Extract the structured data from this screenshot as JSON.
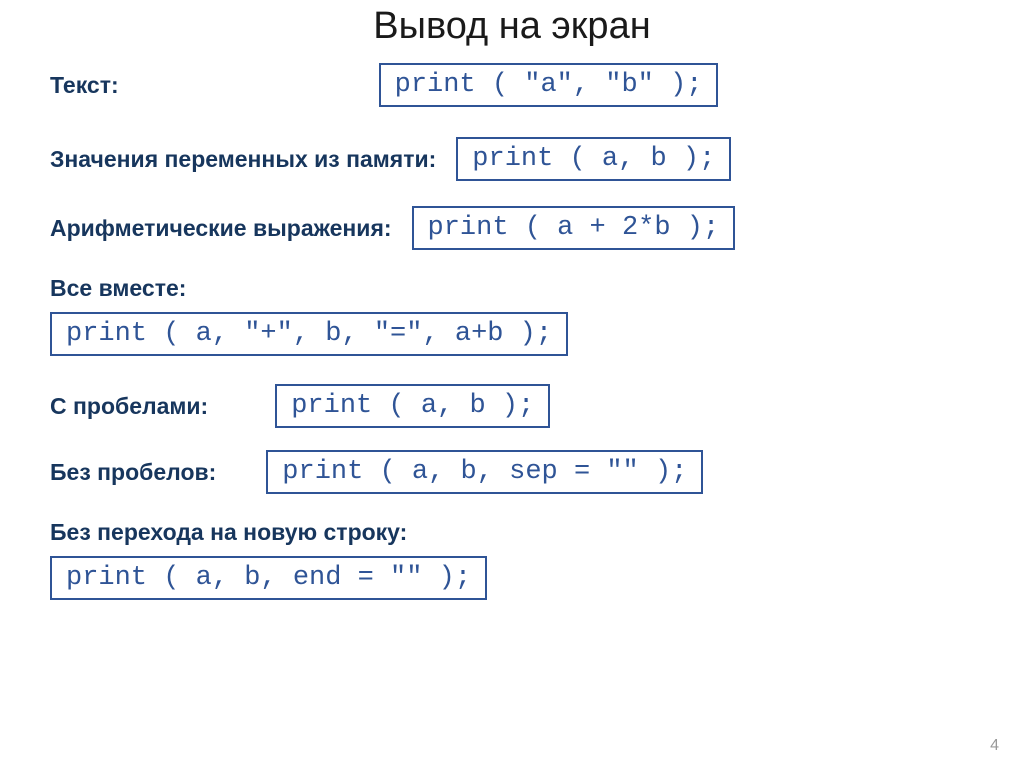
{
  "title": "Вывод на экран",
  "rows": {
    "text": {
      "label": "Текст:",
      "code": "print ( \"a\", \"b\" );"
    },
    "variables": {
      "label": "Значения переменных из памяти:",
      "code": "print ( a, b );"
    },
    "arithmetic": {
      "label": "Арифметические выражения:",
      "code": "print ( a + 2*b );"
    },
    "combined": {
      "label": "Все вместе:",
      "code": "print ( a, \"+\", b, \"=\",  a+b );"
    },
    "with_spaces": {
      "label": "С пробелами:",
      "code": "print ( a, b );"
    },
    "without_spaces": {
      "label": "Без пробелов:",
      "code": "print ( a, b, sep = \"\" );"
    },
    "no_newline": {
      "label": "Без перехода на новую строку:",
      "code": "print ( a, b, end = \"\" );"
    }
  },
  "page_number": "4"
}
